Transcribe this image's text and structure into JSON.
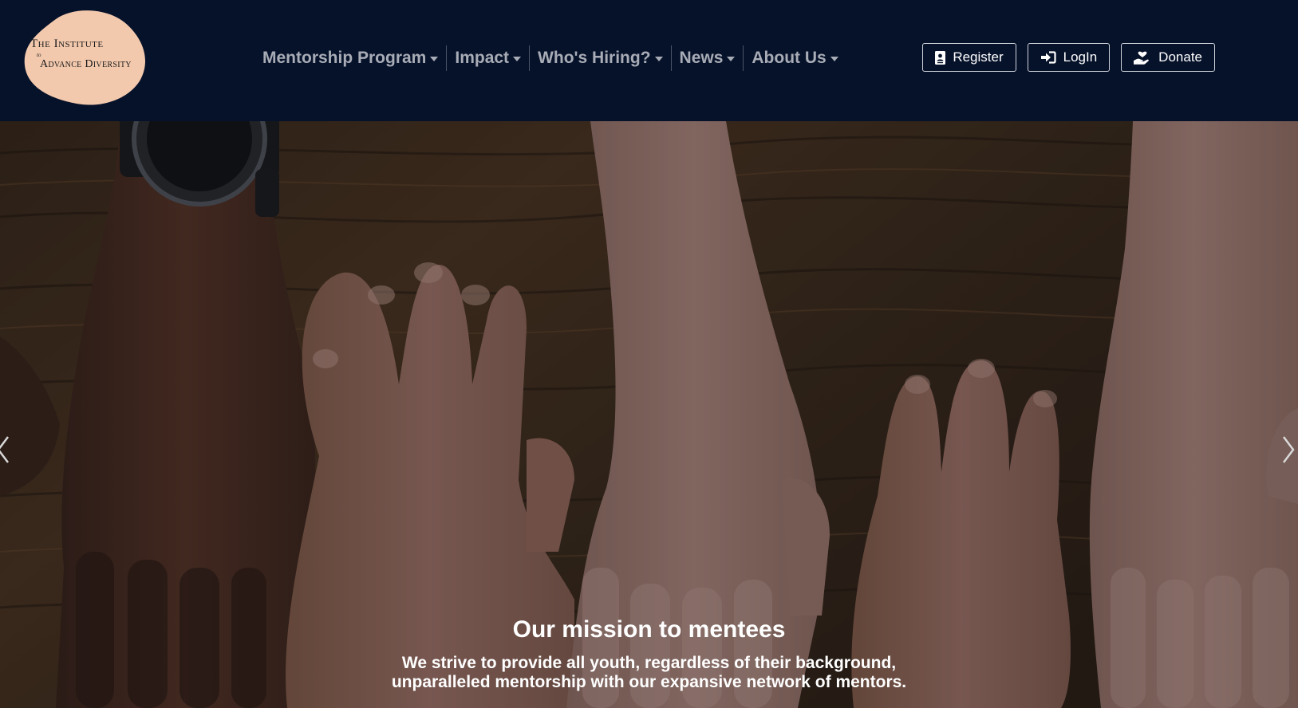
{
  "header": {
    "logo": {
      "line1": "The Institute",
      "to": "to",
      "line2": "Advance Diversity",
      "blob_color": "#f3c9ad"
    },
    "nav": [
      {
        "label": "Mentorship Program"
      },
      {
        "label": "Impact"
      },
      {
        "label": "Who's Hiring?"
      },
      {
        "label": "News"
      },
      {
        "label": "About Us"
      }
    ],
    "actions": {
      "register": "Register",
      "login": "LogIn",
      "donate": "Donate"
    },
    "background": "#06122a"
  },
  "hero": {
    "title": "Our mission to mentees",
    "text": "We strive to provide all youth, regardless of their background, unparalleled mentorship with our expansive network of mentors."
  },
  "icons": {
    "register": "id-badge-icon",
    "login": "sign-in-icon",
    "donate": "hand-holding-heart-icon",
    "prev": "chevron-left-icon",
    "next": "chevron-right-icon"
  }
}
